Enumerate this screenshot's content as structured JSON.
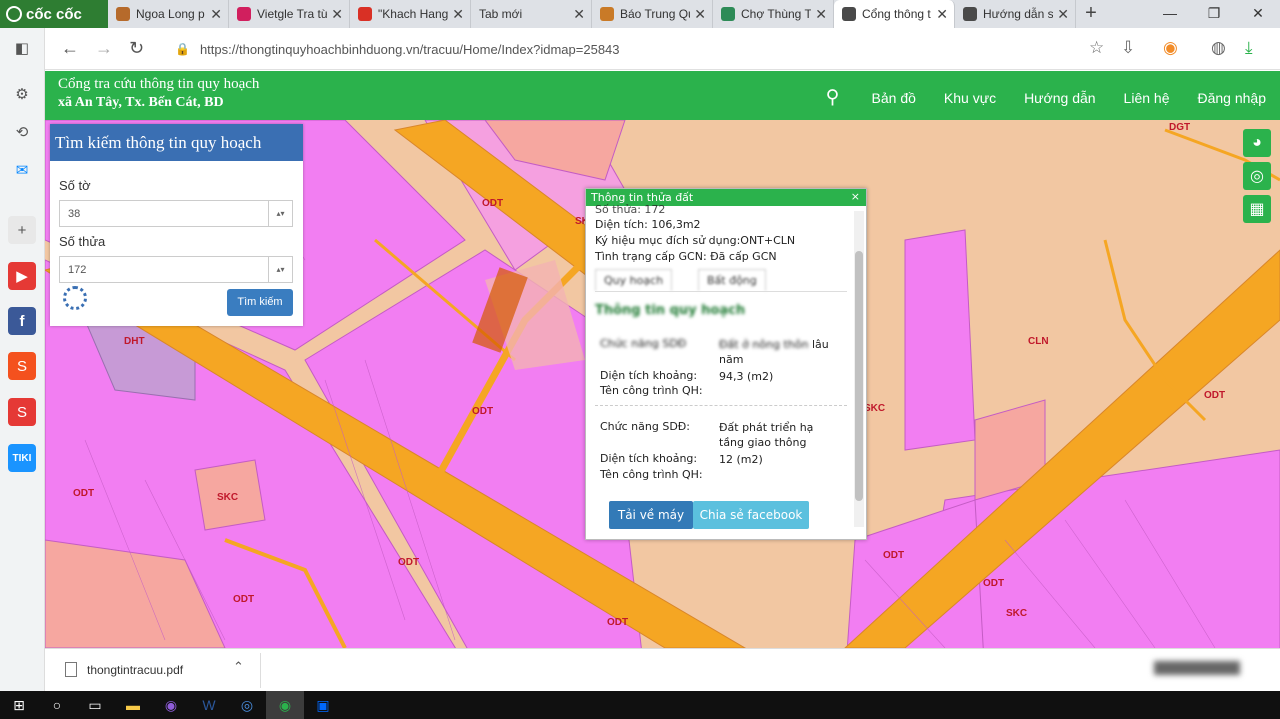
{
  "browser": {
    "brand": "cốc cốc",
    "tabs": [
      {
        "title": "Ngoa Long p",
        "color": "#b66a2b"
      },
      {
        "title": "Vietgle Tra từ",
        "color": "#d11f5e"
      },
      {
        "title": "\"Khach Hang",
        "color": "#d93025"
      },
      {
        "title": "Tab mới",
        "color": "#dee1e6"
      },
      {
        "title": "Báo Trung Qu",
        "color": "#c97a27"
      },
      {
        "title": "Chợ Thùng T",
        "color": "#2e8b57"
      },
      {
        "title": "Cổng thông t",
        "color": "#4a4a4a"
      },
      {
        "title": "Hướng dẫn s",
        "color": "#4a4a4a"
      }
    ],
    "new_tab": "+",
    "url": "https://thongtinquyhoachbinhduong.vn/tracuu/Home/Index?idmap=25843"
  },
  "site": {
    "title": "Cổng tra cứu thông tin quy hoạch",
    "subtitle": "xã An Tây, Tx. Bến Cát, BD",
    "nav": [
      "Bản đồ",
      "Khu vực",
      "Hướng dẫn",
      "Liên hệ",
      "Đăng nhập"
    ]
  },
  "search_panel": {
    "title": "Tìm kiếm thông tin quy hoạch",
    "so_to_label": "Số tờ",
    "so_to_value": "38",
    "so_thua_label": "Số thửa",
    "so_thua_value": "172",
    "button": "Tìm kiếm"
  },
  "popup": {
    "title": "Thông tin thửa đất",
    "close": "×",
    "so_thua_line": "Số thửa: 172",
    "dien_tich_line": "Diện tích: 106,3m2",
    "ky_hieu_line": "Ký hiệu mục đích sử dụng:ONT+CLN",
    "tinh_trang_line": "Tình trạng cấp GCN: Đã cấp GCN",
    "tabs": [
      "Quy hoạch",
      "Bất động"
    ],
    "section_title": "Thông tin quy hoạch",
    "block1": {
      "key_blur": "Chức năng SDĐ",
      "val_blur": "Đất ở nông thôn",
      "val_tail": "lâu năm",
      "area_key": "Diện tích khoảng:",
      "area_val": "94,3 (m2)",
      "name_key": "Tên công trình QH:"
    },
    "block2": {
      "func_key": "Chức năng SDĐ:",
      "func_val": "Đất phát triển hạ tầng giao thông",
      "area_key": "Diện tích khoảng:",
      "area_val": "12 (m2)",
      "name_key": "Tên công trình QH:"
    },
    "download_button": "Tải về máy",
    "share_button": "Chia sẻ facebook"
  },
  "map_labels": [
    {
      "text": "ODT"
    },
    {
      "text": "SK"
    },
    {
      "text": "DHT"
    },
    {
      "text": "ODT"
    },
    {
      "text": "ODT"
    },
    {
      "text": "SKC"
    },
    {
      "text": "ODT"
    },
    {
      "text": "ODT"
    },
    {
      "text": "ODT"
    },
    {
      "text": "SKC"
    },
    {
      "text": "CLN"
    },
    {
      "text": "DGT"
    },
    {
      "text": "ODT"
    },
    {
      "text": "ODT"
    },
    {
      "text": "ODT"
    },
    {
      "text": "SKC"
    }
  ],
  "downloads": {
    "file": "thongtintracuu.pdf"
  },
  "colors": {
    "header_green": "#2bb24c",
    "panel_blue": "#3a6fb3",
    "odt_pink": "#f27ef2",
    "road_orange": "#f5a623",
    "cln_peach": "#f2c7a2"
  }
}
